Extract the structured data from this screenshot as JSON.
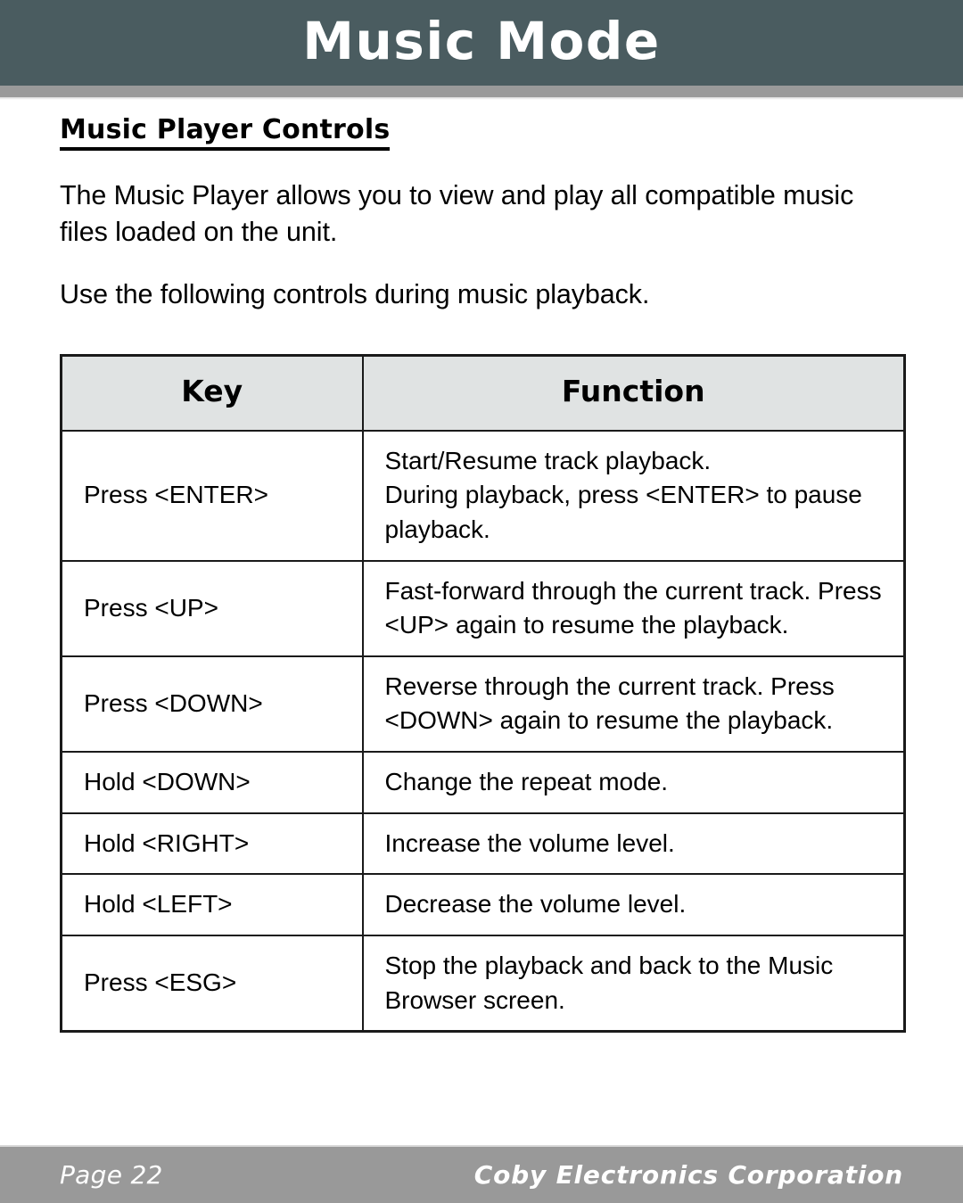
{
  "page": {
    "header_title": "Music Mode",
    "header_bg_color": "#4a5c60",
    "header_rule_color": "#9a9a9a",
    "footer_bg_color": "#999999"
  },
  "body": {
    "section_heading": "Music Player Controls",
    "paragraph_1": "The Music Player allows you to view and play all compatible music files loaded on the unit.",
    "paragraph_2": "Use the following controls during music playback."
  },
  "table": {
    "header_bg_color": "#e0e3e3",
    "columns": [
      "Key",
      "Function"
    ],
    "rows": [
      {
        "key": "Press <ENTER>",
        "function_lines": [
          "Start/Resume track playback.",
          "During playback, press <ENTER> to pause",
          "playback."
        ]
      },
      {
        "key": "Press <UP>",
        "function_lines": [
          "Fast-forward through the current track. Press",
          "<UP> again to resume the playback."
        ]
      },
      {
        "key": "Press <DOWN>",
        "function_lines": [
          "Reverse through the current track. Press",
          "<DOWN> again to resume the playback."
        ]
      },
      {
        "key": "Hold <DOWN>",
        "function_lines": [
          "Change the repeat mode."
        ]
      },
      {
        "key": "Hold <RIGHT>",
        "function_lines": [
          "Increase the volume level."
        ]
      },
      {
        "key": "Hold <LEFT>",
        "function_lines": [
          "Decrease the volume level."
        ]
      },
      {
        "key": "Press <ESG>",
        "function_lines": [
          "Stop the playback and back to the Music",
          "Browser screen."
        ]
      }
    ]
  },
  "footer": {
    "page_label": "Page 22",
    "company": "Coby Electronics Corporation"
  }
}
